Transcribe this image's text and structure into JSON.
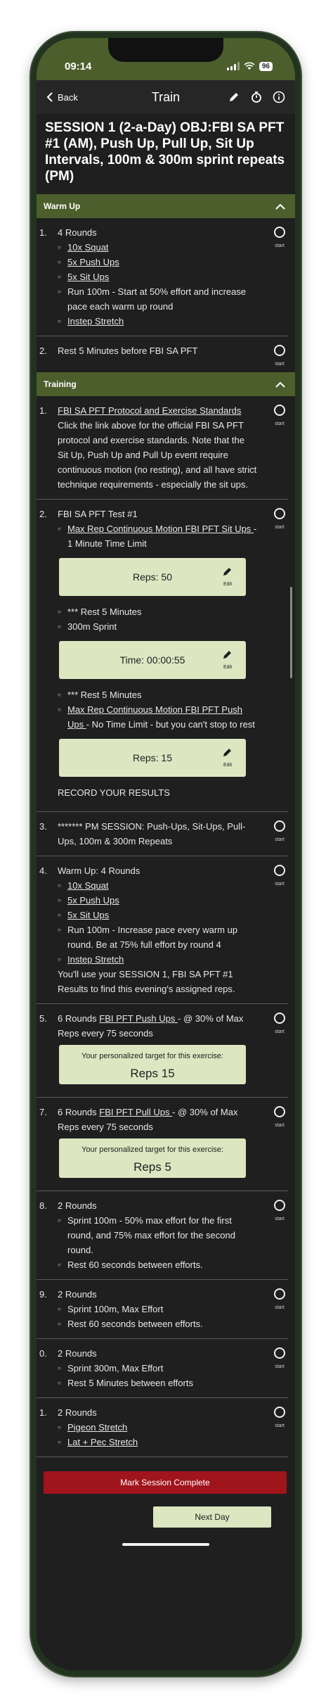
{
  "status": {
    "time": "09:14",
    "battery": "96"
  },
  "nav": {
    "back": "Back",
    "title": "Train"
  },
  "session_title": "SESSION 1 (2-a-Day) OBJ:FBI SA PFT #1 (AM), Push Up, Pull Up, Sit Up Intervals, 100m & 300m sprint repeats (PM)",
  "start_label": "start",
  "edit_label": "Edit",
  "warmup": {
    "header": "Warm Up",
    "items": [
      {
        "num": "1.",
        "title": "4 Rounds",
        "subs": [
          "10x Squat",
          "5x Push Ups",
          "5x Sit Ups",
          "Run 100m - Start at 50% effort and increase pace each warm up round",
          "Instep Stretch"
        ]
      },
      {
        "num": "2.",
        "title": "Rest 5 Minutes before FBI SA PFT"
      }
    ]
  },
  "training": {
    "header": "Training",
    "item1": {
      "num": "1.",
      "link": "FBI SA PFT Protocol and Exercise Standards",
      "text": "Click the link above for the official FBI SA PFT protocol and exercise standards. Note that the Sit Up, Push Up and Pull Up event require continuous motion (no resting), and all have strict technique requirements - especially the sit ups."
    },
    "item2": {
      "num": "2.",
      "title": "FBI SA PFT Test #1",
      "sub1_link": "Max Rep Continuous Motion FBI PFT Sit Ups ",
      "sub1_text": "- 1 Minute Time Limit",
      "reps1": "Reps: 50",
      "sub2": "*** Rest 5 Minutes",
      "sub3": "300m Sprint",
      "time1": "Time: 00:00:55",
      "sub4": "*** Rest 5 Minutes",
      "sub5_link": "Max Rep Continuous Motion FBI PFT Push Ups ",
      "sub5_text": "- No Time Limit - but you can't stop to rest",
      "reps2": "Reps: 15",
      "record": "RECORD YOUR RESULTS"
    },
    "item3": {
      "num": "3.",
      "text": "******* PM SESSION: Push-Ups, Sit-Ups, Pull-Ups, 100m & 300m Repeats"
    },
    "item4": {
      "num": "4.",
      "title": "Warm Up: 4 Rounds",
      "subs": [
        "10x Squat",
        "5x Push Ups",
        "5x Sit Ups",
        "Run 100m - Increase pace every warm up round. Be at 75% full effort by round 4",
        "Instep Stretch"
      ],
      "text": "You'll use your SESSION 1, FBI SA PFT #1 Results to find this evening's assigned reps."
    },
    "item5": {
      "num": "5.",
      "pre": "6 Rounds ",
      "link": "FBI PFT Push Ups ",
      "post": "- @ 30% of Max Reps every 75 seconds",
      "target_label": "Your personalized target for this exercise:",
      "target_value": "Reps 15"
    },
    "item7": {
      "num": "7.",
      "pre": "6 Rounds ",
      "link": "FBI PFT Pull Ups ",
      "post": "- @ 30% of Max Reps every 75 seconds",
      "target_label": "Your personalized target for this exercise:",
      "target_value": "Reps 5"
    },
    "item8": {
      "num": "8.",
      "title": "2 Rounds",
      "subs": [
        "Sprint 100m - 50% max effort for the first round, and 75% max effort for the second round.",
        "Rest 60 seconds between efforts."
      ]
    },
    "item9": {
      "num": "9.",
      "title": "2 Rounds",
      "subs": [
        "Sprint 100m, Max Effort",
        "Rest 60 seconds between efforts."
      ]
    },
    "item10": {
      "num": "0.",
      "title": "2 Rounds",
      "subs": [
        "Sprint 300m, Max Effort",
        "Rest 5 Minutes between efforts"
      ]
    },
    "item11": {
      "num": "1.",
      "title": "2 Rounds",
      "subs": [
        "Pigeon Stretch",
        "Lat + Pec Stretch"
      ]
    }
  },
  "buttons": {
    "complete": "Mark Session Complete",
    "next": "Next Day"
  },
  "colors": {
    "accent": "#4b5e2c",
    "box": "#dce6c1",
    "danger": "#a0141c",
    "background": "#1f1f1f"
  }
}
